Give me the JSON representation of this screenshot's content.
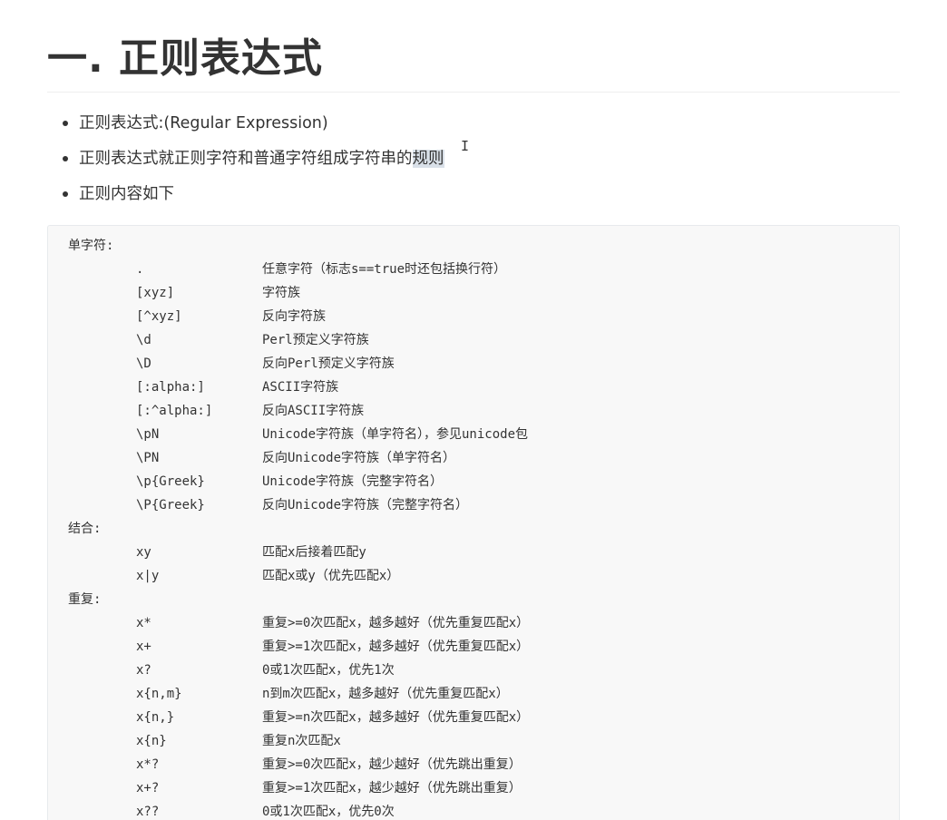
{
  "title": "一. 正则表达式",
  "bullets": [
    {
      "text": "正则表达式:(Regular Expression)"
    },
    {
      "text_before": "正则表达式就正则字符和普通字符组成字符串的",
      "text_highlight": "规则"
    },
    {
      "text": "正则内容如下"
    }
  ],
  "code": {
    "single": {
      "heading": "单字符:",
      "rows": [
        {
          "sym": ".",
          "desc": "任意字符（标志s==true时还包括换行符）"
        },
        {
          "sym": "[xyz]",
          "desc": "字符族"
        },
        {
          "sym": "[^xyz]",
          "desc": "反向字符族"
        },
        {
          "sym": "\\d",
          "desc": "Perl预定义字符族"
        },
        {
          "sym": "\\D",
          "desc": "反向Perl预定义字符族"
        },
        {
          "sym": "[:alpha:]",
          "desc": "ASCII字符族"
        },
        {
          "sym": "[:^alpha:]",
          "desc": "反向ASCII字符族"
        },
        {
          "sym": "\\pN",
          "desc": "Unicode字符族（单字符名），参见unicode包"
        },
        {
          "sym": "\\PN",
          "desc": "反向Unicode字符族（单字符名）"
        },
        {
          "sym": "\\p{Greek}",
          "desc": "Unicode字符族（完整字符名）"
        },
        {
          "sym": "\\P{Greek}",
          "desc": "反向Unicode字符族（完整字符名）"
        }
      ]
    },
    "combine": {
      "heading": "结合:",
      "rows": [
        {
          "sym": "xy",
          "desc": "匹配x后接着匹配y"
        },
        {
          "sym": "x|y",
          "desc": "匹配x或y（优先匹配x）"
        }
      ]
    },
    "repeat": {
      "heading": "重复:",
      "rows": [
        {
          "sym": "x*",
          "desc": "重复>=0次匹配x，越多越好（优先重复匹配x）"
        },
        {
          "sym": "x+",
          "desc": "重复>=1次匹配x，越多越好（优先重复匹配x）"
        },
        {
          "sym": "x?",
          "desc": "0或1次匹配x，优先1次"
        },
        {
          "sym": "x{n,m}",
          "desc": "n到m次匹配x，越多越好（优先重复匹配x）"
        },
        {
          "sym": "x{n,}",
          "desc": "重复>=n次匹配x，越多越好（优先重复匹配x）"
        },
        {
          "sym": "x{n}",
          "desc": "重复n次匹配x"
        },
        {
          "sym": "x*?",
          "desc": "重复>=0次匹配x，越少越好（优先跳出重复）"
        },
        {
          "sym": "x+?",
          "desc": "重复>=1次匹配x，越少越好（优先跳出重复）"
        },
        {
          "sym": "x??",
          "desc": "0或1次匹配x，优先0次"
        }
      ]
    }
  }
}
